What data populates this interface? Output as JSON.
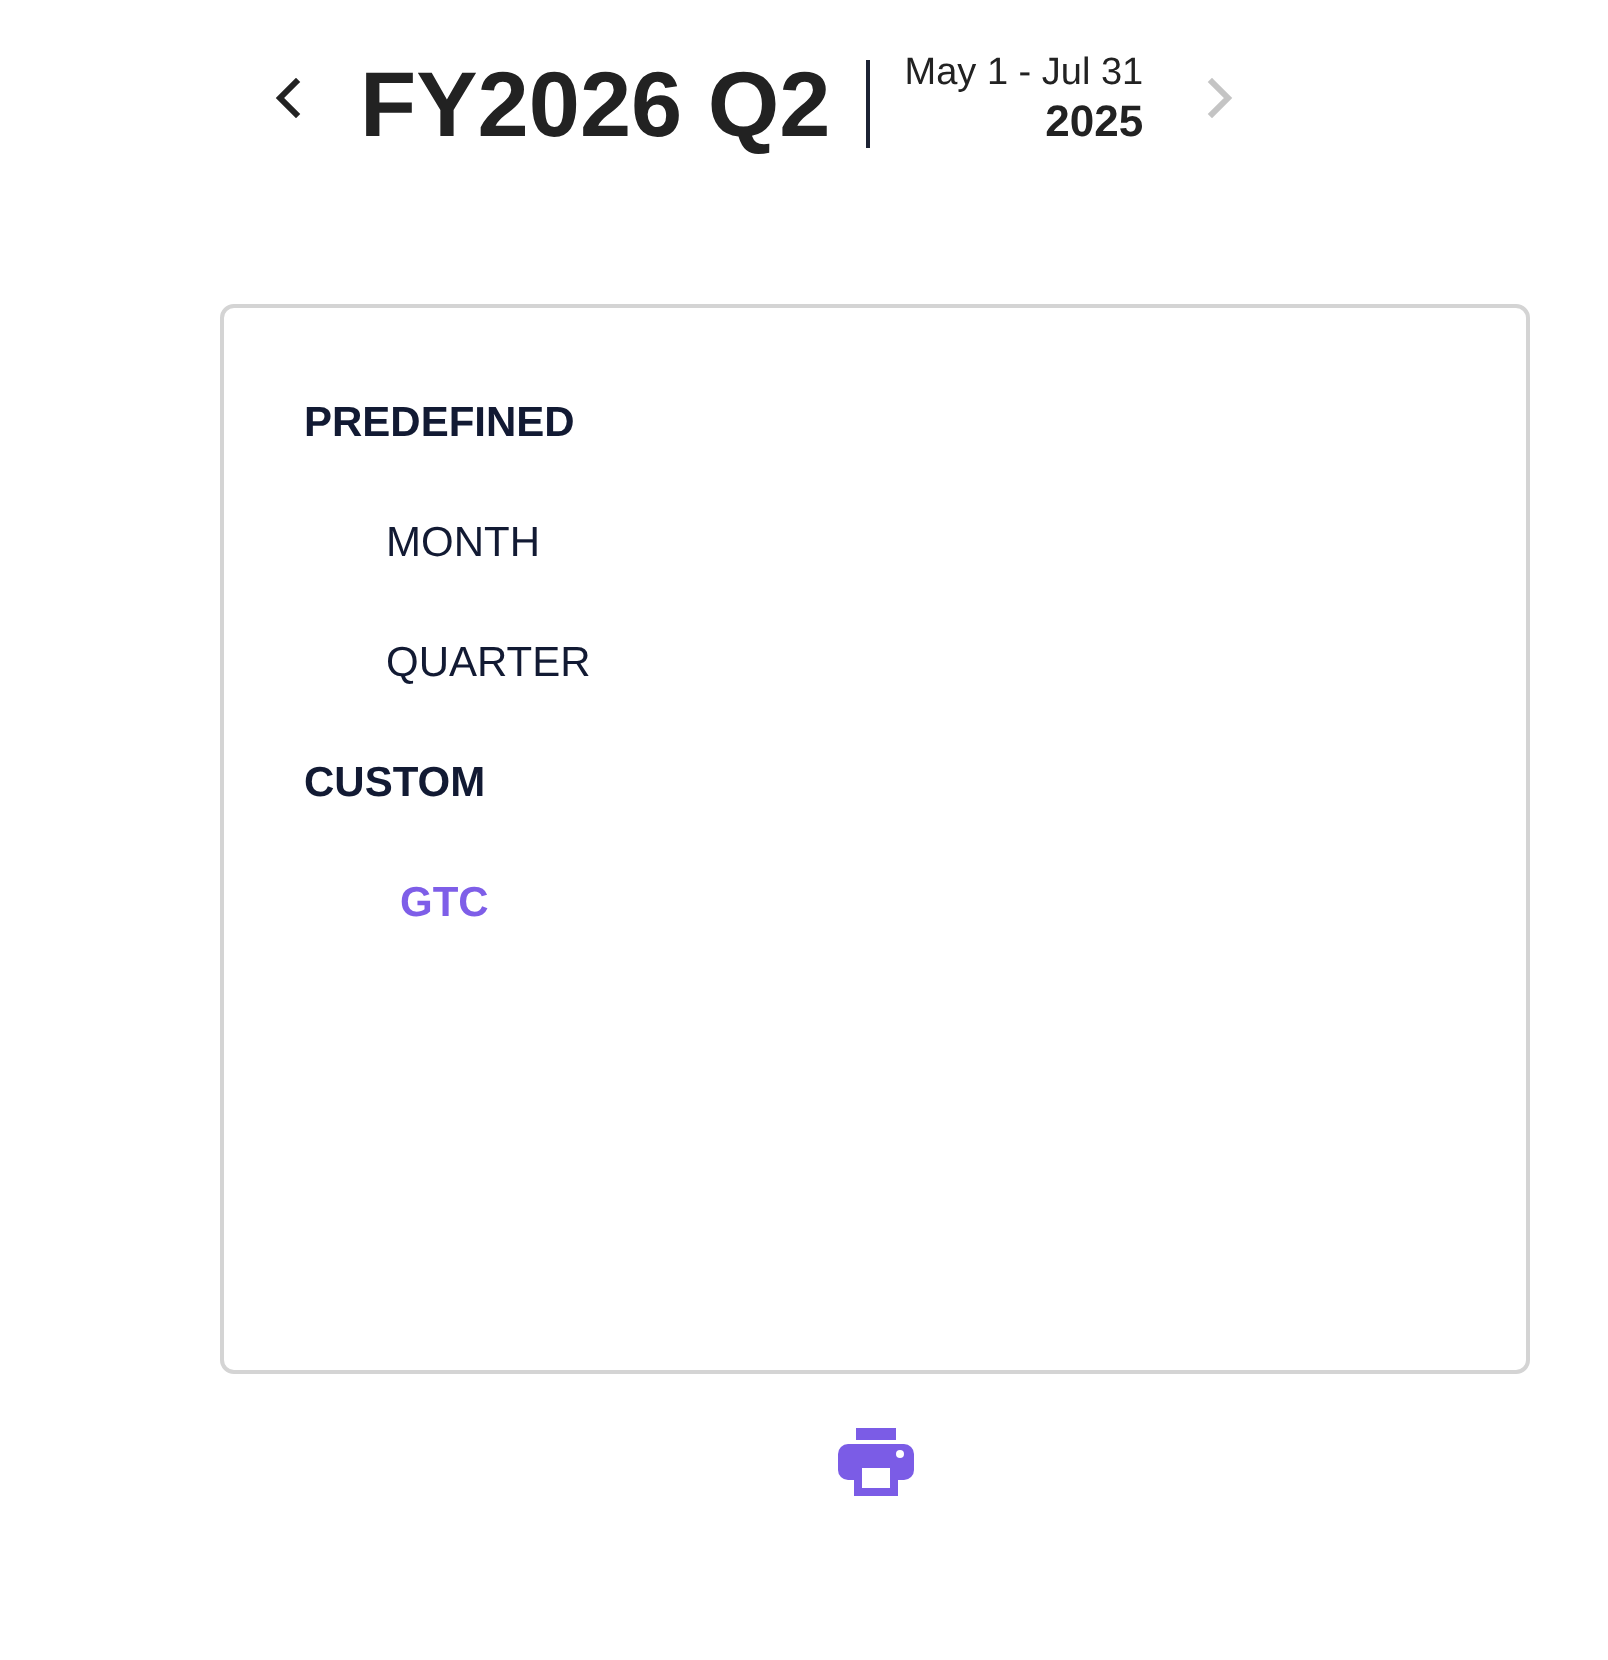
{
  "header": {
    "prev_button": {
      "disabled": false
    },
    "title": "FY2026 Q2",
    "date_range": "May 1 - Jul 31",
    "year": "2025",
    "next_button": {
      "disabled": true
    }
  },
  "panel": {
    "groups": [
      {
        "heading": "PREDEFINED",
        "items": [
          {
            "label": "MONTH",
            "selected": false
          },
          {
            "label": "QUARTER",
            "selected": false
          }
        ]
      },
      {
        "heading": "CUSTOM",
        "items": [
          {
            "label": "GTC",
            "selected": true
          }
        ]
      }
    ]
  }
}
